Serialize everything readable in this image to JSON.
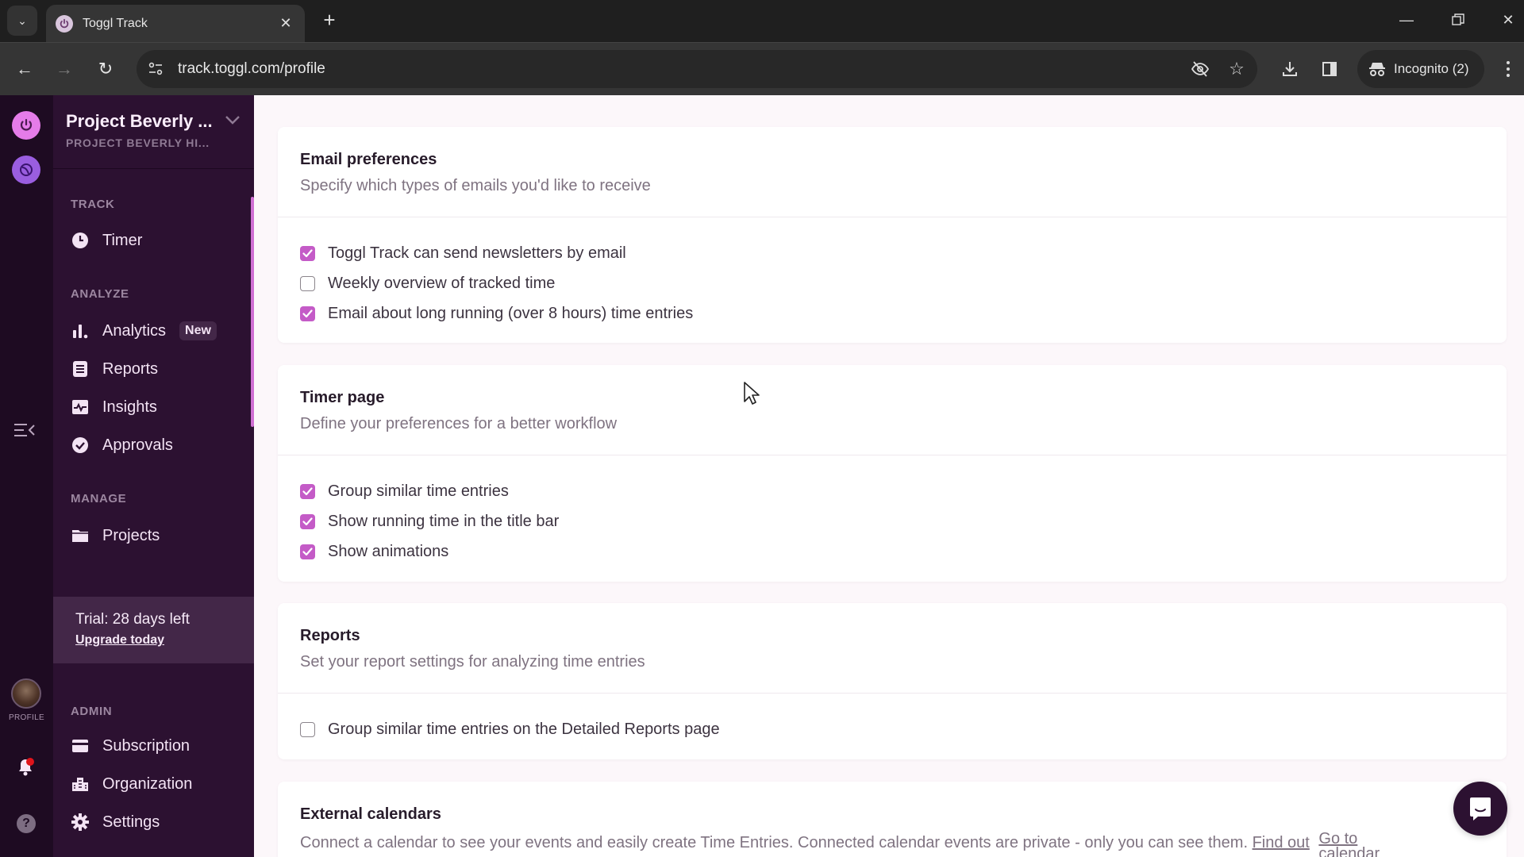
{
  "browser": {
    "tab_title": "Toggl Track",
    "url": "track.toggl.com/profile",
    "incognito_label": "Incognito (2)"
  },
  "rail": {
    "profile_label": "PROFILE"
  },
  "sidebar": {
    "workspace_name": "Project Beverly ...",
    "organization_name": "PROJECT BEVERLY HI...",
    "sections": {
      "track": "TRACK",
      "analyze": "ANALYZE",
      "manage": "MANAGE",
      "admin": "ADMIN"
    },
    "items": {
      "timer": "Timer",
      "analytics": "Analytics",
      "analytics_badge": "New",
      "reports": "Reports",
      "insights": "Insights",
      "approvals": "Approvals",
      "projects": "Projects",
      "subscription": "Subscription",
      "organization": "Organization",
      "settings": "Settings"
    },
    "trial": {
      "text": "Trial: 28 days left",
      "link": "Upgrade today"
    }
  },
  "main": {
    "email": {
      "title": "Email preferences",
      "subtitle": "Specify which types of emails you'd like to receive",
      "options": [
        {
          "label": "Toggl Track can send newsletters by email",
          "checked": true
        },
        {
          "label": "Weekly overview of tracked time",
          "checked": false
        },
        {
          "label": "Email about long running (over 8 hours) time entries",
          "checked": true
        }
      ]
    },
    "timer": {
      "title": "Timer page",
      "subtitle": "Define your preferences for a better workflow",
      "options": [
        {
          "label": "Group similar time entries",
          "checked": true
        },
        {
          "label": "Show running time in the title bar",
          "checked": true
        },
        {
          "label": "Show animations",
          "checked": true
        }
      ]
    },
    "reports": {
      "title": "Reports",
      "subtitle": "Set your report settings for analyzing time entries",
      "options": [
        {
          "label": "Group similar time entries on the Detailed Reports page",
          "checked": false
        }
      ]
    },
    "calendars": {
      "title": "External calendars",
      "description": "Connect a calendar to see your events and easily create Time Entries. Connected calendar events are private - only you can see them.",
      "find_out_link": "Find out",
      "go_to_line1": "Go to",
      "go_to_line2": "calendar"
    }
  },
  "colors": {
    "accent": "#c45bc7",
    "sidebar_bg": "#2c1131",
    "rail_bg": "#1e0b22",
    "trial_bg": "#432748"
  }
}
